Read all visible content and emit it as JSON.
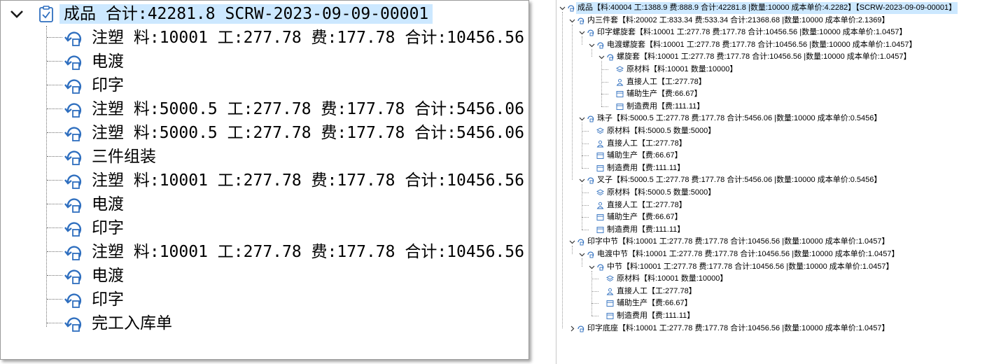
{
  "left_tree": {
    "root_label": "成品 合计:42281.8 SCRW-2023-09-09-00001",
    "items": [
      "注塑 料:10001 工:277.78 费:177.78 合计:10456.56",
      "电渡",
      "印字",
      "注塑 料:5000.5 工:277.78 费:177.78 合计:5456.06",
      "注塑 料:5000.5 工:277.78 费:177.78 合计:5456.06",
      "三件组装",
      "注塑 料:10001 工:277.78 费:177.78 合计:10456.56",
      "电渡",
      "印字",
      "注塑 料:10001 工:277.78 费:177.78 合计:10456.56",
      "电渡",
      "印字",
      "完工入库单"
    ]
  },
  "right_tree": {
    "rows": [
      {
        "label": "成品【料:40004 工:1388.9 费:888.9 合计:42281.8 |数量:10000 成本单价:4.2282】【SCRW-2023-09-09-00001】",
        "level": 0,
        "expander": "expanded",
        "icon": "root-product-icon",
        "selected": true
      },
      {
        "label": "内三件套【料:20002 工:833.34 费:533.34 合计:21368.68 |数量:10000 成本单价:2.1369】",
        "level": 1,
        "expander": "expanded",
        "icon": "process-node-icon",
        "selected": false
      },
      {
        "label": "印字螺旋套【料:10001 工:277.78 费:177.78 合计:10456.56 |数量:10000 成本单价:1.0457】",
        "level": 2,
        "expander": "expanded",
        "icon": "process-node-icon",
        "selected": false
      },
      {
        "label": "电渡螺旋套【料:10001 工:277.78 费:177.78 合计:10456.56 |数量:10000 成本单价:1.0457】",
        "level": 3,
        "expander": "expanded",
        "icon": "process-node-icon",
        "selected": false
      },
      {
        "label": "螺旋套【料:10001 工:277.78 费:177.78 合计:10456.56 |数量:10000 成本单价:1.0457】",
        "level": 4,
        "expander": "expanded",
        "icon": "process-node-icon",
        "selected": false
      },
      {
        "label": "原材料【料:10001 数量:10000】",
        "level": 5,
        "expander": "none",
        "icon": "material-stack-icon",
        "selected": false
      },
      {
        "label": "直接人工【工:277.78】",
        "level": 5,
        "expander": "none",
        "icon": "person-icon",
        "selected": false
      },
      {
        "label": "辅助生产【费:66.67】",
        "level": 5,
        "expander": "none",
        "icon": "box-icon",
        "selected": false
      },
      {
        "label": "制造费用【费:111.11】",
        "level": 5,
        "expander": "none",
        "icon": "box-icon",
        "selected": false
      },
      {
        "label": "珠子【料:5000.5 工:277.78 费:177.78 合计:5456.06 |数量:10000 成本单价:0.5456】",
        "level": 2,
        "expander": "expanded",
        "icon": "process-node-icon",
        "selected": false
      },
      {
        "label": "原材料【料:5000.5 数量:5000】",
        "level": 3,
        "expander": "none",
        "icon": "material-stack-icon",
        "selected": false
      },
      {
        "label": "直接人工【工:277.78】",
        "level": 3,
        "expander": "none",
        "icon": "person-icon",
        "selected": false
      },
      {
        "label": "辅助生产【费:66.67】",
        "level": 3,
        "expander": "none",
        "icon": "box-icon",
        "selected": false
      },
      {
        "label": "制造费用【费:111.11】",
        "level": 3,
        "expander": "none",
        "icon": "box-icon",
        "selected": false
      },
      {
        "label": "叉子【料:5000.5 工:277.78 费:177.78 合计:5456.06 |数量:10000 成本单价:0.5456】",
        "level": 2,
        "expander": "expanded",
        "icon": "process-node-icon",
        "selected": false
      },
      {
        "label": "原材料【料:5000.5 数量:5000】",
        "level": 3,
        "expander": "none",
        "icon": "material-stack-icon",
        "selected": false
      },
      {
        "label": "直接人工【工:277.78】",
        "level": 3,
        "expander": "none",
        "icon": "person-icon",
        "selected": false
      },
      {
        "label": "辅助生产【费:66.67】",
        "level": 3,
        "expander": "none",
        "icon": "box-icon",
        "selected": false
      },
      {
        "label": "制造费用【费:111.11】",
        "level": 3,
        "expander": "none",
        "icon": "box-icon",
        "selected": false
      },
      {
        "label": "印字中节【料:10001 工:277.78 费:177.78 合计:10456.56 |数量:10000 成本单价:1.0457】",
        "level": 1,
        "expander": "expanded",
        "icon": "process-node-icon",
        "selected": false
      },
      {
        "label": "电渡中节【料:10001 工:277.78 费:177.78 合计:10456.56 |数量:10000 成本单价:1.0457】",
        "level": 2,
        "expander": "expanded",
        "icon": "process-node-icon",
        "selected": false
      },
      {
        "label": "中节【料:10001 工:277.78 费:177.78 合计:10456.56 |数量:10000 成本单价:1.0457】",
        "level": 3,
        "expander": "expanded",
        "icon": "process-node-icon",
        "selected": false
      },
      {
        "label": "原材料【料:10001 数量:10000】",
        "level": 4,
        "expander": "none",
        "icon": "material-stack-icon",
        "selected": false
      },
      {
        "label": "直接人工【工:277.78】",
        "level": 4,
        "expander": "none",
        "icon": "person-icon",
        "selected": false
      },
      {
        "label": "辅助生产【费:66.67】",
        "level": 4,
        "expander": "none",
        "icon": "box-icon",
        "selected": false
      },
      {
        "label": "制造费用【费:111.11】",
        "level": 4,
        "expander": "none",
        "icon": "box-icon",
        "selected": false
      },
      {
        "label": "印字底座【料:10001 工:277.78 费:177.78 合计:10456.56 |数量:10000 成本单价:1.0457】",
        "level": 1,
        "expander": "collapsed",
        "icon": "process-node-icon",
        "selected": false
      }
    ]
  },
  "colors": {
    "selection": "#cce8ff",
    "icon_blue": "#2f6fbf",
    "tree_line": "#9a9a9a"
  }
}
